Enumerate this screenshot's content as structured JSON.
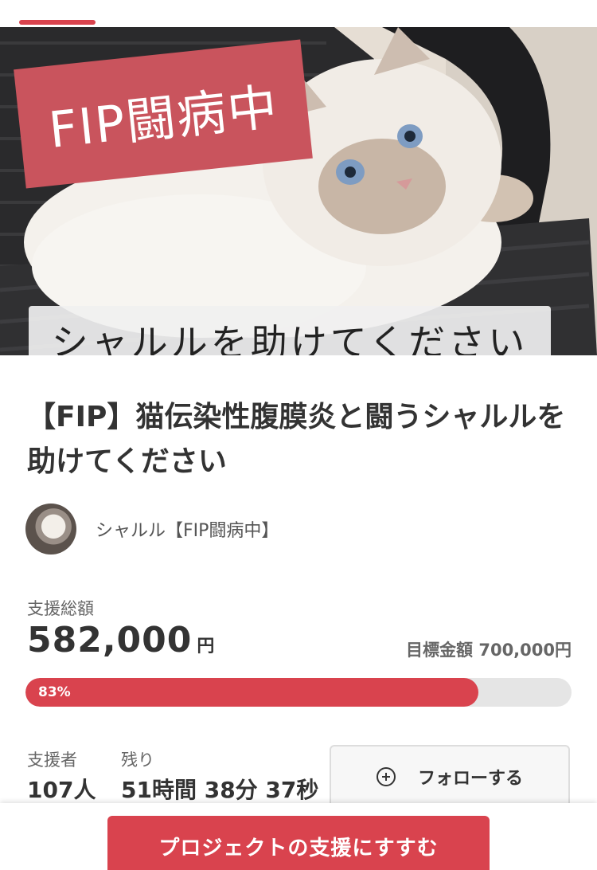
{
  "hero": {
    "badge_text": "FIP闘病中",
    "caption_text": "シャルルを助けてください"
  },
  "project": {
    "title": "【FIP】猫伝染性腹膜炎と闘うシャルルを助けてください",
    "owner_name": "シャルル【FIP闘病中】"
  },
  "funding": {
    "total_label": "支援総額",
    "total_amount": "582,000",
    "currency": "円",
    "goal_text": "目標金額 700,000円",
    "progress_percent": 83,
    "progress_label": "83%"
  },
  "stats": {
    "supporters_label": "支援者",
    "supporters_value": "107人",
    "remaining_label": "残り",
    "remaining_value": "51時間 38分 37秒"
  },
  "actions": {
    "follow_label": "フォローする",
    "support_label": "プロジェクトの支援にすすむ"
  },
  "colors": {
    "accent": "#d9434e",
    "badge": "#c9545d",
    "track": "#e5e5e5"
  },
  "icons": [
    "plus-circle-icon"
  ]
}
